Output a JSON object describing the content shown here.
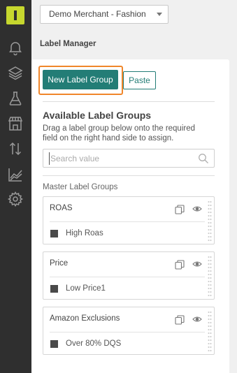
{
  "nav": {
    "icons": [
      "notifications-icon",
      "layers-icon",
      "flask-icon",
      "store-icon",
      "sort-arrows-icon",
      "analytics-chart-icon",
      "settings-gear-icon"
    ]
  },
  "header": {
    "merchant": "Demo Merchant - Fashion",
    "page_title": "Label Manager"
  },
  "toolbar": {
    "new_label_group": "New Label Group",
    "paste": "Paste"
  },
  "available": {
    "title": "Available Label Groups",
    "description": "Drag a label group below onto the required field on the right hand side to assign."
  },
  "search": {
    "placeholder": "Search value"
  },
  "master": {
    "heading": "Master Label Groups",
    "groups": [
      {
        "name": "ROAS",
        "label": "High Roas"
      },
      {
        "name": "Price",
        "label": "Low Price1"
      },
      {
        "name": "Amazon Exclusions",
        "label": "Over 80% DQS"
      }
    ]
  },
  "colors": {
    "sidebar": "#2f2f2f",
    "brand": "#c6d72e",
    "accent": "#237d76",
    "highlight": "#f0862a",
    "label_swatch": "#4a4a4a"
  }
}
